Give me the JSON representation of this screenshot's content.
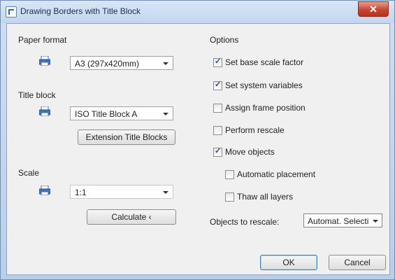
{
  "window": {
    "title": "Drawing Borders with Title Block",
    "close_glyph": "✕"
  },
  "paper_format": {
    "label": "Paper format",
    "value": "A3 (297x420mm)",
    "icon": "printer-icon"
  },
  "title_block": {
    "label": "Title block",
    "value": "ISO Title Block A",
    "icon": "printer-icon",
    "extension_button": "Extension Title Blocks"
  },
  "scale": {
    "label": "Scale",
    "value": "1:1",
    "icon": "printer-icon",
    "calculate_button": "Calculate ‹"
  },
  "options": {
    "label": "Options",
    "checkboxes": [
      {
        "label": "Set base scale factor",
        "checked": true
      },
      {
        "label": "Set system variables",
        "checked": true
      },
      {
        "label": "Assign frame position",
        "checked": false
      },
      {
        "label": "Perform rescale",
        "checked": false
      },
      {
        "label": "Move objects",
        "checked": true
      },
      {
        "label": "Automatic placement",
        "checked": false
      },
      {
        "label": "Thaw all layers",
        "checked": false
      }
    ],
    "rescale_label": "Objects to rescale:",
    "rescale_value": "Automat. Selecti"
  },
  "buttons": {
    "ok": "OK",
    "cancel": "Cancel"
  },
  "colors": {
    "frame": "#c3d6ee",
    "client": "#f0f0f0",
    "close": "#c8452f",
    "checkmark": "#2a4f7a"
  }
}
